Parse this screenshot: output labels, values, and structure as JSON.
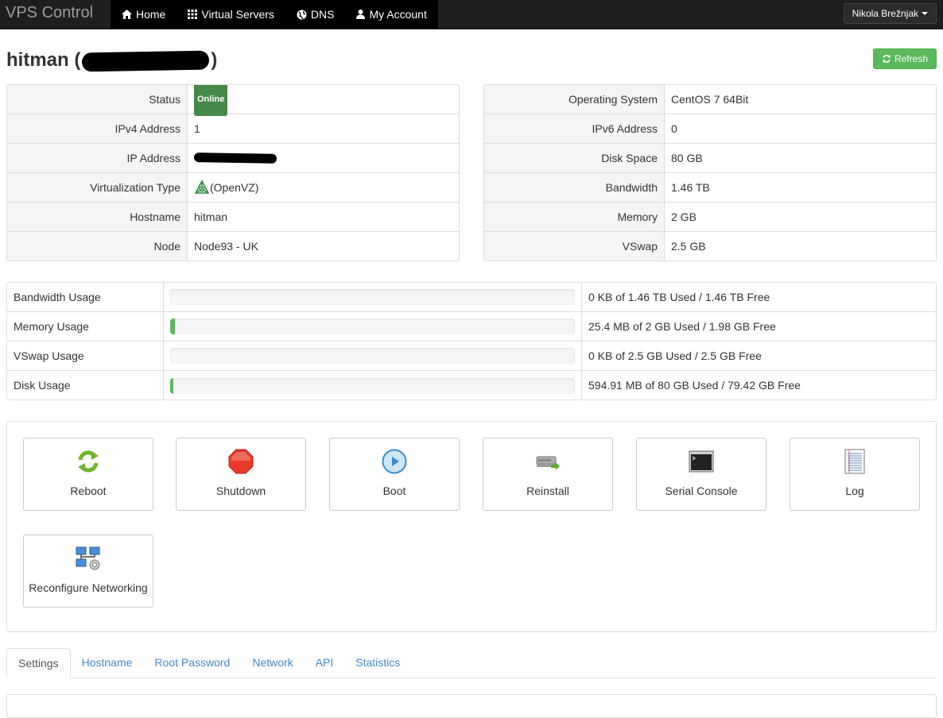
{
  "navbar": {
    "brand": "VPS Control",
    "items": [
      {
        "label": "Home",
        "icon": "home-icon"
      },
      {
        "label": "Virtual Servers",
        "icon": "grid-icon"
      },
      {
        "label": "DNS",
        "icon": "globe-icon"
      },
      {
        "label": "My Account",
        "icon": "user-icon"
      }
    ],
    "user": "Nikola Brežnjak"
  },
  "header": {
    "title_prefix": "hitman (",
    "title_suffix": ")",
    "refresh_label": "Refresh"
  },
  "left_info": [
    {
      "label": "Status",
      "value": "Online"
    },
    {
      "label": "IPv4 Address",
      "value": "1"
    },
    {
      "label": "IP Address",
      "value": ""
    },
    {
      "label": "Virtualization Type",
      "value": "(OpenVZ)"
    },
    {
      "label": "Hostname",
      "value": "hitman"
    },
    {
      "label": "Node",
      "value": "Node93 - UK"
    }
  ],
  "right_info": [
    {
      "label": "Operating System",
      "value": "CentOS 7 64Bit"
    },
    {
      "label": "IPv6 Address",
      "value": "0"
    },
    {
      "label": "Disk Space",
      "value": "80 GB"
    },
    {
      "label": "Bandwidth",
      "value": "1.46 TB"
    },
    {
      "label": "Memory",
      "value": "2 GB"
    },
    {
      "label": "VSwap",
      "value": "2.5 GB"
    }
  ],
  "usage": [
    {
      "label": "Bandwidth Usage",
      "percent": 0,
      "text": "0 KB of 1.46 TB Used / 1.46 TB Free"
    },
    {
      "label": "Memory Usage",
      "percent": 1.2,
      "text": "25.4 MB of 2 GB Used / 1.98 GB Free"
    },
    {
      "label": "VSwap Usage",
      "percent": 0,
      "text": "0 KB of 2.5 GB Used / 2.5 GB Free"
    },
    {
      "label": "Disk Usage",
      "percent": 0.7,
      "text": "594.91 MB of 80 GB Used / 79.42 GB Free"
    }
  ],
  "actions": [
    {
      "label": "Reboot",
      "icon": "reboot-icon"
    },
    {
      "label": "Shutdown",
      "icon": "shutdown-icon"
    },
    {
      "label": "Boot",
      "icon": "boot-icon"
    },
    {
      "label": "Reinstall",
      "icon": "reinstall-icon"
    },
    {
      "label": "Serial Console",
      "icon": "console-icon"
    },
    {
      "label": "Log",
      "icon": "log-icon"
    },
    {
      "label": "Reconfigure Networking",
      "icon": "network-icon"
    }
  ],
  "tabs": [
    {
      "label": "Settings",
      "active": true
    },
    {
      "label": "Hostname"
    },
    {
      "label": "Root Password"
    },
    {
      "label": "Network"
    },
    {
      "label": "API"
    },
    {
      "label": "Statistics"
    }
  ],
  "colors": {
    "navbar_bg": "#1f1f1f",
    "success": "#5cb85c",
    "online_badge": "#468847",
    "link": "#428bca"
  }
}
